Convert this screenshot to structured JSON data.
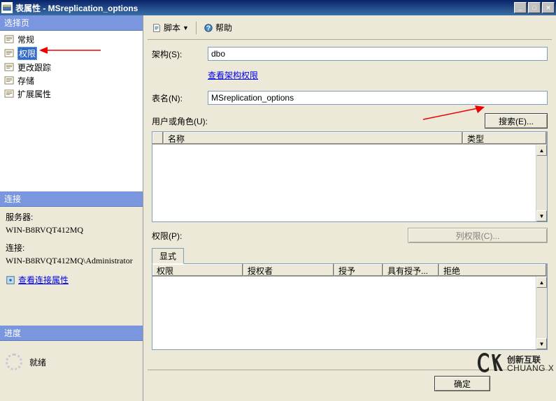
{
  "window": {
    "title": "表属性 - MSreplication_options"
  },
  "sidebar": {
    "header": "选择页",
    "items": [
      {
        "label": "常规"
      },
      {
        "label": "权限"
      },
      {
        "label": "更改跟踪"
      },
      {
        "label": "存储"
      },
      {
        "label": "扩展属性"
      }
    ]
  },
  "connection": {
    "header": "连接",
    "server_label": "服务器:",
    "server_value": "WIN-B8RVQT412MQ",
    "conn_label": "连接:",
    "conn_value": "WIN-B8RVQT412MQ\\Administrator",
    "view_link": "查看连接属性"
  },
  "progress": {
    "header": "进度",
    "status": "就绪"
  },
  "toolbar": {
    "script": "脚本",
    "help": "帮助"
  },
  "form": {
    "schema_label": "架构(S):",
    "schema_value": "dbo",
    "view_schema_perm": "查看架构权限",
    "table_label": "表名(N):",
    "table_value": "MSreplication_options",
    "users_label": "用户或角色(U):",
    "search_btn": "搜索(E)...",
    "grid_col_name": "名称",
    "grid_col_type": "类型",
    "perm_label": "权限(P):",
    "col_perm_btn": "列权限(C)...",
    "tab_explicit": "显式",
    "col_perm": "权限",
    "col_grantor": "授权者",
    "col_grant": "授予",
    "col_with_grant": "具有授予...",
    "col_deny": "拒绝"
  },
  "footer": {
    "ok": "确定"
  },
  "watermark": {
    "brand": "创新互联",
    "sub": "CHUANG XIN HU LIAN"
  }
}
